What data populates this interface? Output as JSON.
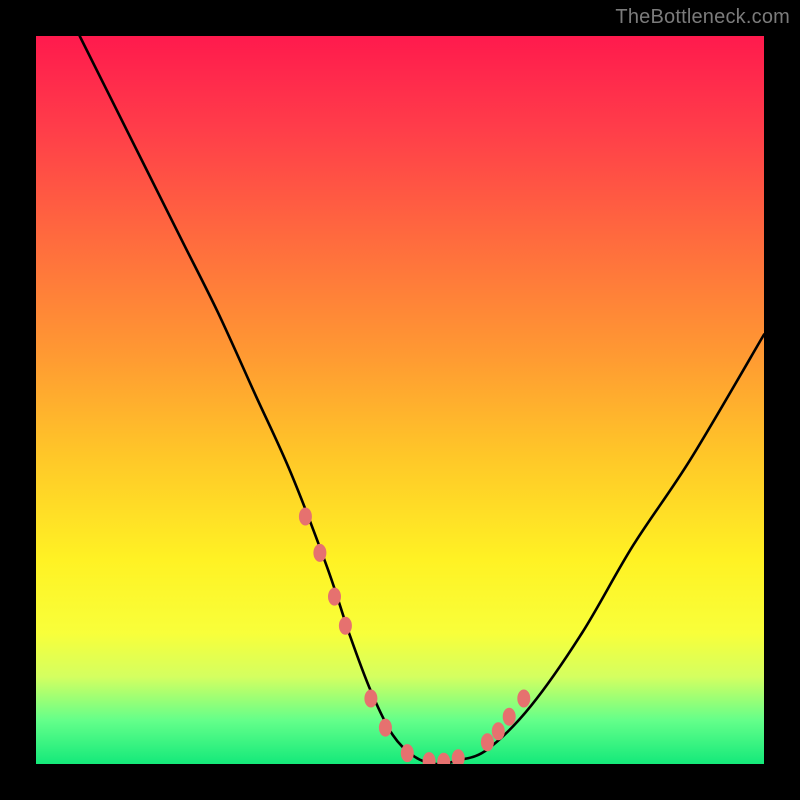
{
  "watermark": "TheBottleneck.com",
  "chart_data": {
    "type": "line",
    "title": "",
    "xlabel": "",
    "ylabel": "",
    "xlim": [
      0,
      100
    ],
    "ylim": [
      0,
      100
    ],
    "series": [
      {
        "name": "curve",
        "x": [
          6,
          10,
          15,
          20,
          25,
          30,
          35,
          40,
          43,
          46,
          49,
          52,
          55,
          58,
          62,
          68,
          75,
          82,
          90,
          100
        ],
        "y": [
          100,
          92,
          82,
          72,
          62,
          51,
          40,
          27,
          18,
          10,
          4,
          1,
          0,
          0.5,
          2,
          8,
          18,
          30,
          42,
          59
        ]
      }
    ],
    "markers": {
      "name": "highlight-dots",
      "x": [
        37,
        39,
        41,
        42.5,
        46,
        48,
        51,
        54,
        56,
        58,
        62,
        63.5,
        65,
        67
      ],
      "y": [
        34,
        29,
        23,
        19,
        9,
        5,
        1.5,
        0.4,
        0.3,
        0.8,
        3,
        4.5,
        6.5,
        9
      ]
    },
    "gradient_stops": [
      {
        "pos": 0,
        "color": "#ff1a4d"
      },
      {
        "pos": 28,
        "color": "#ff6b3e"
      },
      {
        "pos": 58,
        "color": "#ffc828"
      },
      {
        "pos": 82,
        "color": "#f8ff3a"
      },
      {
        "pos": 100,
        "color": "#14e97a"
      }
    ]
  }
}
